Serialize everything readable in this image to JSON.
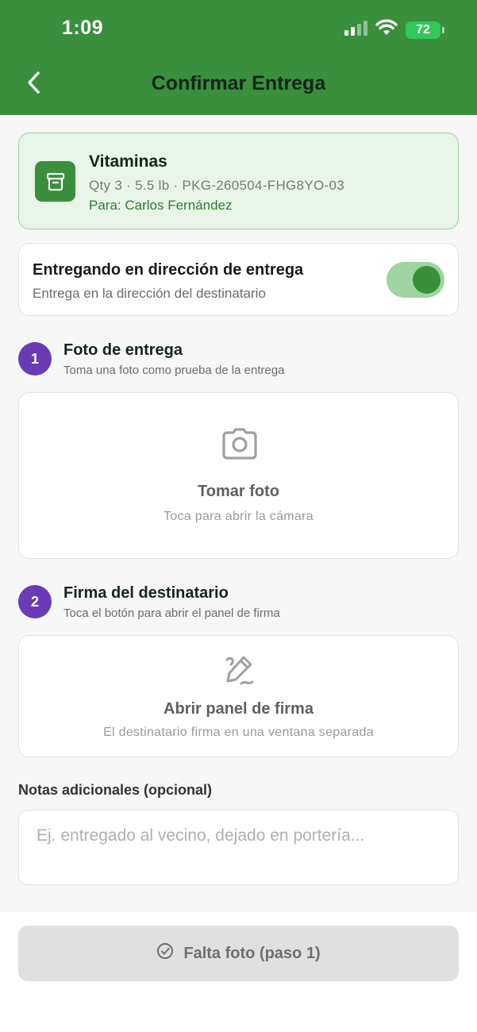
{
  "status_bar": {
    "time": "1:09",
    "battery": "72"
  },
  "header": {
    "title": "Confirmar Entrega",
    "bg_color": "#3a8f3c"
  },
  "package": {
    "name": "Vitaminas",
    "meta": "Qty 3 · 5.5 lb · PKG-260504-FHG8YO-03",
    "recipient": "Para: Carlos Fernández",
    "icon": "archive-box-icon"
  },
  "delivery_toggle": {
    "title": "Entregando en dirección de entrega",
    "subtitle": "Entrega en la dirección del destinatario",
    "checked": true
  },
  "steps": [
    {
      "number": "1",
      "title": "Foto de entrega",
      "subtitle": "Toma una foto como prueba de la entrega",
      "action_title": "Tomar foto",
      "action_subtitle": "Toca para abrir la cámara",
      "icon": "camera-icon"
    },
    {
      "number": "2",
      "title": "Firma del destinatario",
      "subtitle": "Toca el botón para abrir el panel de firma",
      "action_title": "Abrir panel de firma",
      "action_subtitle": "El destinatario firma en una ventana separada",
      "icon": "signature-icon"
    }
  ],
  "notes": {
    "label": "Notas adicionales (opcional)",
    "placeholder": "Ej. entregado al vecino, dejado en portería...",
    "value": ""
  },
  "submit": {
    "label": "Falta foto (paso 1)",
    "disabled": true
  },
  "colors": {
    "brand_green": "#3a8f3c",
    "step_purple": "#6a3bb5",
    "package_bg": "#e8f5e8",
    "toggle_track": "#9fd39f"
  }
}
